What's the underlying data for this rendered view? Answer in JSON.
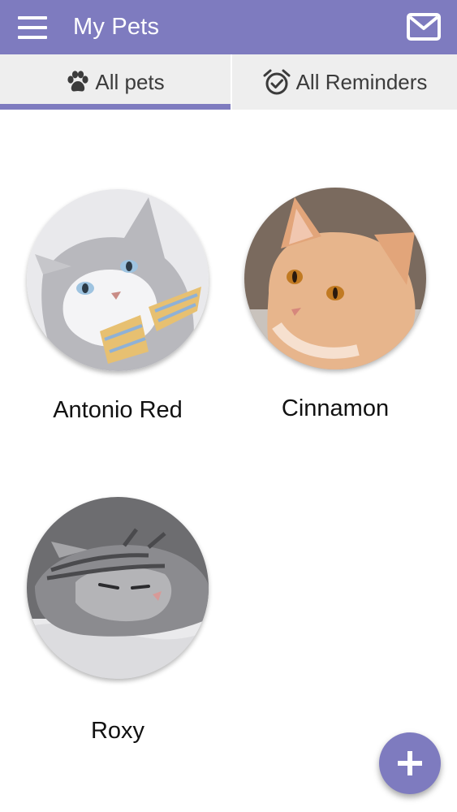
{
  "appbar": {
    "title": "My Pets",
    "menu_icon": "hamburger-menu-icon",
    "mail_icon": "mail-icon",
    "color": "#7e7bbf"
  },
  "tabs": [
    {
      "label": "All pets",
      "icon": "paw-icon",
      "selected": true
    },
    {
      "label": "All Reminders",
      "icon": "alarm-clock-icon",
      "selected": false
    }
  ],
  "pets": [
    {
      "name": "Antonio Red",
      "photo": "white-grey cat with blue eyes wearing a striped bow tie"
    },
    {
      "name": "Cinnamon",
      "photo": "orange tabby cat with amber eyes"
    },
    {
      "name": "Roxy",
      "photo": "grey tabby cat sleeping on a white blanket"
    }
  ],
  "fab": {
    "icon": "plus-icon"
  }
}
